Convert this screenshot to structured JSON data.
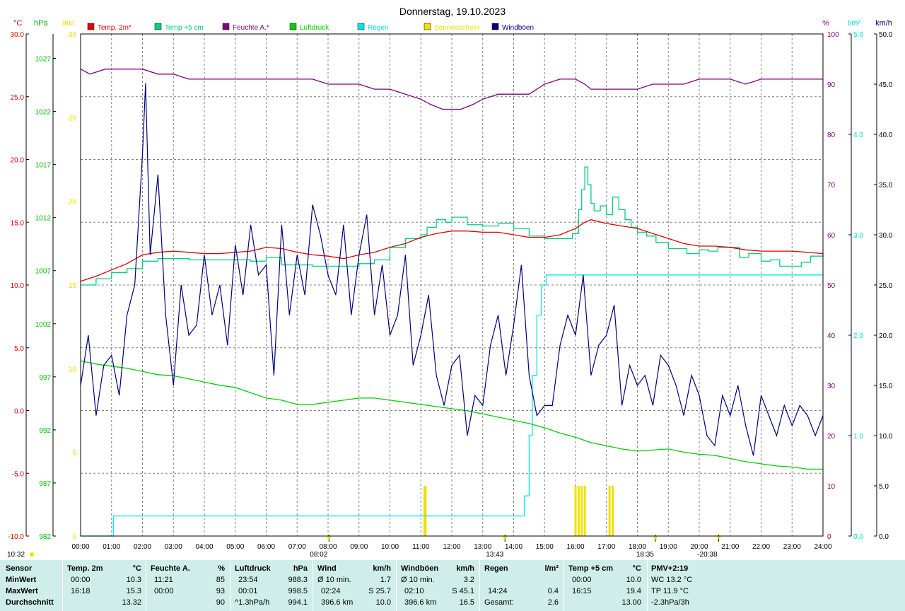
{
  "chart_data": {
    "type": "line",
    "title": "Donnerstag, 19.10.2023",
    "x_ticks": [
      "00:00",
      "01:00",
      "02:00",
      "03:00",
      "04:00",
      "05:00",
      "06:00",
      "07:00",
      "08:00",
      "09:00",
      "10:00",
      "11:00",
      "12:00",
      "13:00",
      "14:00",
      "15:00",
      "16:00",
      "17:00",
      "18:00",
      "19:00",
      "20:00",
      "21:00",
      "22:00",
      "23:00",
      "24:00"
    ],
    "x_range_hours": [
      0,
      24
    ],
    "grid": true,
    "axes": {
      "temp": {
        "unit": "°C",
        "range": [
          -10,
          30
        ],
        "ticks": [
          "30.0",
          "25.0",
          "20.0",
          "15.0",
          "10.0",
          "5.0",
          "0.0",
          "-5.0",
          "-10.0"
        ],
        "color": "#e00000"
      },
      "pressure": {
        "unit": "hPa",
        "range": [
          982,
          1029.3
        ],
        "ticks": [
          "1027",
          "1022",
          "1017",
          "1012",
          "1007",
          "1002",
          "997",
          "992",
          "987",
          "982"
        ],
        "color": "#00c000"
      },
      "sunshine": {
        "unit": "min",
        "range": [
          0,
          30
        ],
        "ticks": [
          "30",
          "25",
          "20",
          "15",
          "10",
          "5",
          "0"
        ],
        "color": "#f0e000"
      },
      "humidity": {
        "unit": "%",
        "range": [
          0,
          100
        ],
        "ticks": [
          "100",
          "90",
          "80",
          "70",
          "60",
          "50",
          "40",
          "30",
          "20",
          "10",
          "0"
        ],
        "color": "#800080"
      },
      "rain": {
        "unit": "l/m²",
        "range": [
          0,
          5
        ],
        "ticks": [
          "5.0",
          "4.0",
          "3.0",
          "2.0",
          "1.0",
          "0.0"
        ],
        "color": "#00e0e0"
      },
      "wind": {
        "unit": "km/h",
        "range": [
          0,
          50
        ],
        "ticks": [
          "50.0",
          "45.0",
          "40.0",
          "35.0",
          "30.0",
          "25.0",
          "20.0",
          "15.0",
          "10.0",
          "5.0",
          "0.0"
        ],
        "color": "#000080"
      }
    },
    "legend": [
      {
        "name": "Temp. 2m*",
        "color": "#e00000"
      },
      {
        "name": "Temp +5 cm",
        "color": "#00d080"
      },
      {
        "name": "Feuchte A.*",
        "color": "#800080"
      },
      {
        "name": "Luftdruck",
        "color": "#00d000"
      },
      {
        "name": "Regen",
        "color": "#00e8e8"
      },
      {
        "name": "Sonnenschein",
        "color": "#f0e000"
      },
      {
        "name": "Windböen",
        "color": "#000080"
      }
    ],
    "series": [
      {
        "name": "Temp. 2m*",
        "axis": "temp",
        "x": [
          0,
          0.5,
          1,
          1.5,
          2,
          2.5,
          3,
          3.5,
          4,
          4.5,
          5,
          5.5,
          6,
          6.5,
          7,
          7.5,
          8,
          8.5,
          9,
          9.5,
          10,
          10.5,
          11,
          11.5,
          12,
          12.5,
          13,
          13.5,
          14,
          14.5,
          15,
          15.5,
          16,
          16.3,
          16.5,
          17,
          17.5,
          18,
          18.5,
          19,
          19.5,
          20,
          20.5,
          21,
          21.5,
          22,
          22.5,
          23,
          23.5,
          24
        ],
        "y": [
          10.3,
          10.7,
          11.2,
          11.7,
          12.4,
          12.6,
          12.7,
          12.6,
          12.5,
          12.5,
          12.6,
          12.7,
          13.0,
          12.9,
          12.6,
          12.4,
          12.3,
          12.1,
          12.4,
          12.6,
          13.0,
          13.3,
          13.8,
          14.1,
          14.3,
          14.3,
          14.2,
          14.2,
          14.0,
          13.8,
          13.8,
          14.0,
          14.5,
          15.0,
          15.2,
          14.9,
          14.7,
          14.5,
          14.1,
          13.7,
          13.3,
          13.1,
          13.1,
          13.0,
          12.8,
          12.7,
          12.7,
          12.7,
          12.6,
          12.5
        ]
      },
      {
        "name": "Temp +5 cm",
        "axis": "temp",
        "x": [
          0,
          0.5,
          1,
          1.5,
          2,
          2.5,
          3,
          3.5,
          4,
          4.5,
          5,
          5.5,
          6,
          6.5,
          7,
          7.5,
          8,
          8.5,
          9,
          9.5,
          10,
          10.5,
          11,
          11.2,
          11.5,
          11.8,
          12,
          12.5,
          13,
          13.5,
          14,
          14.5,
          15,
          15.5,
          15.9,
          16.1,
          16.2,
          16.3,
          16.4,
          16.5,
          16.6,
          16.8,
          17,
          17.2,
          17.4,
          17.6,
          17.8,
          18,
          18.3,
          18.6,
          19,
          19.3,
          19.6,
          20,
          20.3,
          20.6,
          21,
          21.3,
          21.6,
          22,
          22.3,
          22.6,
          23,
          23.3,
          23.6,
          24
        ],
        "y": [
          10.0,
          10.5,
          11.0,
          11.3,
          11.9,
          12.1,
          12.1,
          12.0,
          12.0,
          12.0,
          12.0,
          11.9,
          12.2,
          11.6,
          11.6,
          11.5,
          11.5,
          11.5,
          11.7,
          12.0,
          13.0,
          13.7,
          14.0,
          14.6,
          15.2,
          15.0,
          15.4,
          14.8,
          14.7,
          14.9,
          14.5,
          13.9,
          13.7,
          13.7,
          14.1,
          16.0,
          17.6,
          19.4,
          18.0,
          16.5,
          15.9,
          16.3,
          15.6,
          17.0,
          16.0,
          15.2,
          14.6,
          14.2,
          13.9,
          13.4,
          12.9,
          12.9,
          12.5,
          12.8,
          12.7,
          13.0,
          13.0,
          12.2,
          12.5,
          11.9,
          12.0,
          11.5,
          11.5,
          11.8,
          12.3,
          12.5
        ]
      },
      {
        "name": "Feuchte A.*",
        "axis": "humidity",
        "x": [
          0,
          0.3,
          0.8,
          1.5,
          2,
          2.5,
          3,
          3.5,
          4,
          4.5,
          5,
          5.5,
          6,
          6.5,
          7,
          7.5,
          8,
          8.5,
          9,
          9.5,
          10,
          10.5,
          11,
          11.3,
          11.7,
          12,
          12.3,
          12.7,
          13,
          13.5,
          14,
          14.5,
          15,
          15.5,
          16,
          16.3,
          16.5,
          17,
          17.5,
          18,
          18.5,
          19,
          19.5,
          20,
          20.5,
          21,
          21.5,
          22,
          22.5,
          23,
          23.5,
          24
        ],
        "y": [
          93,
          92,
          93,
          93,
          93,
          92,
          92,
          91,
          91,
          91,
          91,
          91,
          91,
          91,
          91,
          91,
          90,
          90,
          90,
          89,
          89,
          88,
          87,
          86,
          85,
          85,
          85,
          86,
          87,
          88,
          88,
          88,
          90,
          91,
          91,
          90,
          89,
          89,
          89,
          89,
          90,
          90,
          90,
          91,
          91,
          91,
          90,
          91,
          91,
          91,
          91,
          91
        ]
      },
      {
        "name": "Luftdruck",
        "axis": "pressure",
        "x": [
          0,
          0.5,
          1,
          1.5,
          2,
          2.5,
          3,
          3.5,
          4,
          4.5,
          5,
          5.5,
          6,
          6.5,
          7,
          7.5,
          8,
          8.5,
          9,
          9.5,
          10,
          10.5,
          11,
          11.5,
          12,
          12.5,
          13,
          13.5,
          14,
          14.5,
          15,
          15.5,
          16,
          16.5,
          17,
          17.5,
          18,
          18.5,
          19,
          19.5,
          20,
          20.5,
          21,
          21.5,
          22,
          22.5,
          23,
          23.5,
          24
        ],
        "y": [
          998.5,
          998.2,
          998.0,
          997.8,
          997.5,
          997.2,
          997.1,
          996.8,
          996.5,
          996.2,
          996.0,
          995.5,
          995.0,
          994.8,
          994.4,
          994.4,
          994.6,
          994.8,
          995.0,
          995.0,
          994.8,
          994.6,
          994.4,
          994.2,
          994.0,
          993.8,
          993.5,
          993.2,
          992.9,
          992.6,
          992.2,
          991.7,
          991.3,
          990.8,
          990.5,
          990.2,
          990.0,
          990.1,
          990.2,
          989.9,
          989.7,
          989.6,
          989.3,
          989.0,
          988.8,
          988.6,
          988.5,
          988.3,
          988.3
        ]
      },
      {
        "name": "Regen",
        "axis": "rain",
        "x": [
          0,
          1.05,
          1.06,
          14.1,
          14.2,
          14.35,
          14.5,
          14.6,
          14.75,
          14.9,
          15.05,
          24
        ],
        "y": [
          0,
          0,
          0.2,
          0.2,
          0.2,
          0.4,
          1.0,
          1.6,
          2.2,
          2.5,
          2.6,
          2.6
        ]
      },
      {
        "name": "Windböen",
        "axis": "wind",
        "x": [
          0,
          0.25,
          0.5,
          0.75,
          1,
          1.25,
          1.5,
          1.75,
          2,
          2.1,
          2.25,
          2.5,
          2.75,
          3,
          3.25,
          3.5,
          3.75,
          4,
          4.25,
          4.5,
          4.75,
          5,
          5.25,
          5.5,
          5.75,
          6,
          6.25,
          6.5,
          6.75,
          7,
          7.25,
          7.5,
          7.75,
          8,
          8.25,
          8.5,
          8.75,
          9,
          9.25,
          9.5,
          9.75,
          10,
          10.25,
          10.5,
          10.75,
          11,
          11.25,
          11.5,
          11.75,
          12,
          12.25,
          12.5,
          12.75,
          13,
          13.25,
          13.5,
          13.75,
          14,
          14.25,
          14.5,
          14.75,
          15,
          15.25,
          15.5,
          15.75,
          16,
          16.25,
          16.5,
          16.75,
          17,
          17.25,
          17.5,
          17.75,
          18,
          18.25,
          18.5,
          18.75,
          19,
          19.25,
          19.5,
          19.75,
          20,
          20.25,
          20.5,
          20.75,
          21,
          21.25,
          21.5,
          21.75,
          22,
          22.25,
          22.5,
          22.75,
          23,
          23.25,
          23.5,
          23.75,
          24
        ],
        "y": [
          15,
          20,
          12,
          17,
          18,
          14,
          22,
          25,
          38,
          45.1,
          28,
          36,
          22,
          15,
          25,
          20,
          21,
          28,
          22,
          25,
          19,
          29,
          24,
          31,
          26,
          27,
          16,
          31,
          22,
          28,
          24,
          33,
          30,
          26,
          24,
          31,
          22,
          28,
          32,
          22,
          27,
          20,
          22,
          28,
          17,
          20,
          24,
          16,
          13,
          17,
          18,
          10,
          14,
          13,
          19,
          22,
          16,
          21,
          27,
          16,
          12,
          13,
          13,
          19,
          22,
          20,
          26,
          16,
          19,
          20,
          23,
          13,
          17,
          15,
          16,
          13,
          18,
          17,
          15,
          12,
          16,
          14,
          10,
          9,
          14,
          12,
          15,
          11,
          8,
          14,
          12,
          10,
          13,
          11,
          13,
          12,
          10,
          12
        ]
      }
    ],
    "sunshine_bars": {
      "axis": "sunshine",
      "x": [
        11.12,
        11.15,
        16.0,
        16.1,
        16.2,
        16.3,
        17.1,
        17.2
      ],
      "y": [
        3,
        3,
        3,
        3,
        3,
        3,
        3,
        3
      ]
    },
    "bottom_markers": [
      {
        "label": "10:32",
        "hour": null,
        "left_edge": true
      },
      {
        "label": "08:02",
        "hour": 8.03
      },
      {
        "label": "13:43",
        "hour": 13.72
      },
      {
        "label": "18:35",
        "hour": 18.58
      },
      {
        "label": "-20:38",
        "hour": 20.63
      }
    ]
  },
  "summary": {
    "col_sensor": {
      "header": "Sensor",
      "rows": [
        "MinWert",
        "MaxWert",
        "Durchschnitt"
      ]
    },
    "col_temp": {
      "header": "Temp. 2m",
      "unit": "°C",
      "times": [
        "00:00",
        "16:18",
        ""
      ],
      "values": [
        "10.3",
        "15.3",
        "13.32"
      ]
    },
    "col_hum": {
      "header": "Feuchte A.",
      "unit": "%",
      "times": [
        "11:21",
        "00:00",
        ""
      ],
      "values": [
        "85",
        "93",
        "90"
      ]
    },
    "col_press": {
      "header": "Luftdruck",
      "unit": "hPa",
      "times": [
        "23:54",
        "00:01",
        "^1.3hPa/h"
      ],
      "values": [
        "988.3",
        "998.5",
        "994.1"
      ]
    },
    "col_wind": {
      "header": "Wind",
      "unit": "km/h",
      "times": [
        "Ø 10 min.",
        "02:24",
        "396.6 km"
      ],
      "values": [
        "1.7",
        "S 25.7",
        "10.0"
      ]
    },
    "col_gust": {
      "header": "Windböen",
      "unit": "km/h",
      "times": [
        "Ø 10 min.",
        "02:10",
        "396.6 km"
      ],
      "values": [
        "3.2",
        "S 45.1",
        "16.5"
      ]
    },
    "col_rain": {
      "header": "Regen",
      "unit": "l/m²",
      "times": [
        "",
        "14:24",
        "Gesamt:"
      ],
      "values": [
        "",
        "0.4",
        "2.6"
      ]
    },
    "col_t5": {
      "header": "Temp +5 cm",
      "unit": "°C",
      "times": [
        "00:00",
        "16:15",
        ""
      ],
      "values": [
        "10.0",
        "19.4",
        "13.00"
      ]
    },
    "col_pmv": {
      "header": "PMV+2:19",
      "rows": [
        "WC 13.2 °C",
        "TP 11.9 °C",
        "-2.3hPa/3h"
      ]
    }
  }
}
